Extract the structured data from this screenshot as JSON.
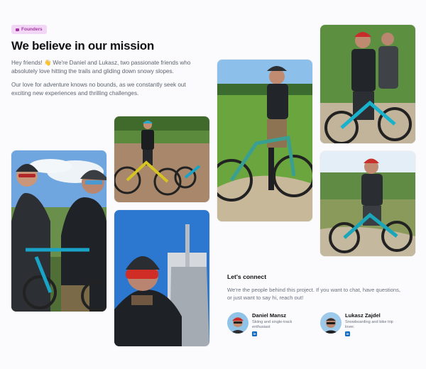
{
  "badge": {
    "label": "Founders"
  },
  "hero": {
    "title": "We believe in our mission",
    "intro_1": "Hey friends! 👋 We're Daniel and Lukasz, two passionate friends who absolutely love hitting the trails and gliding down snowy slopes.",
    "intro_2": "Our love for adventure knows no bounds, as we constantly seek out exciting new experiences and thrilling challenges."
  },
  "connect": {
    "title": "Let's connect",
    "text": "We're the people behind this project. If you want to chat, have questions, or just want to say hi, reach out!",
    "people": [
      {
        "name": "Daniel Mansz",
        "role": "Skiing and single-track enthusiast",
        "social": "in"
      },
      {
        "name": "Lukasz Zajdel",
        "role": "Snowboarding and bike trip lover.",
        "social": "in"
      }
    ]
  },
  "colors": {
    "badge_bg": "#f1d6f6",
    "badge_text": "#a5389f",
    "linkedin": "#0a66c2",
    "heading": "#111111",
    "body_text": "#5d6470"
  }
}
